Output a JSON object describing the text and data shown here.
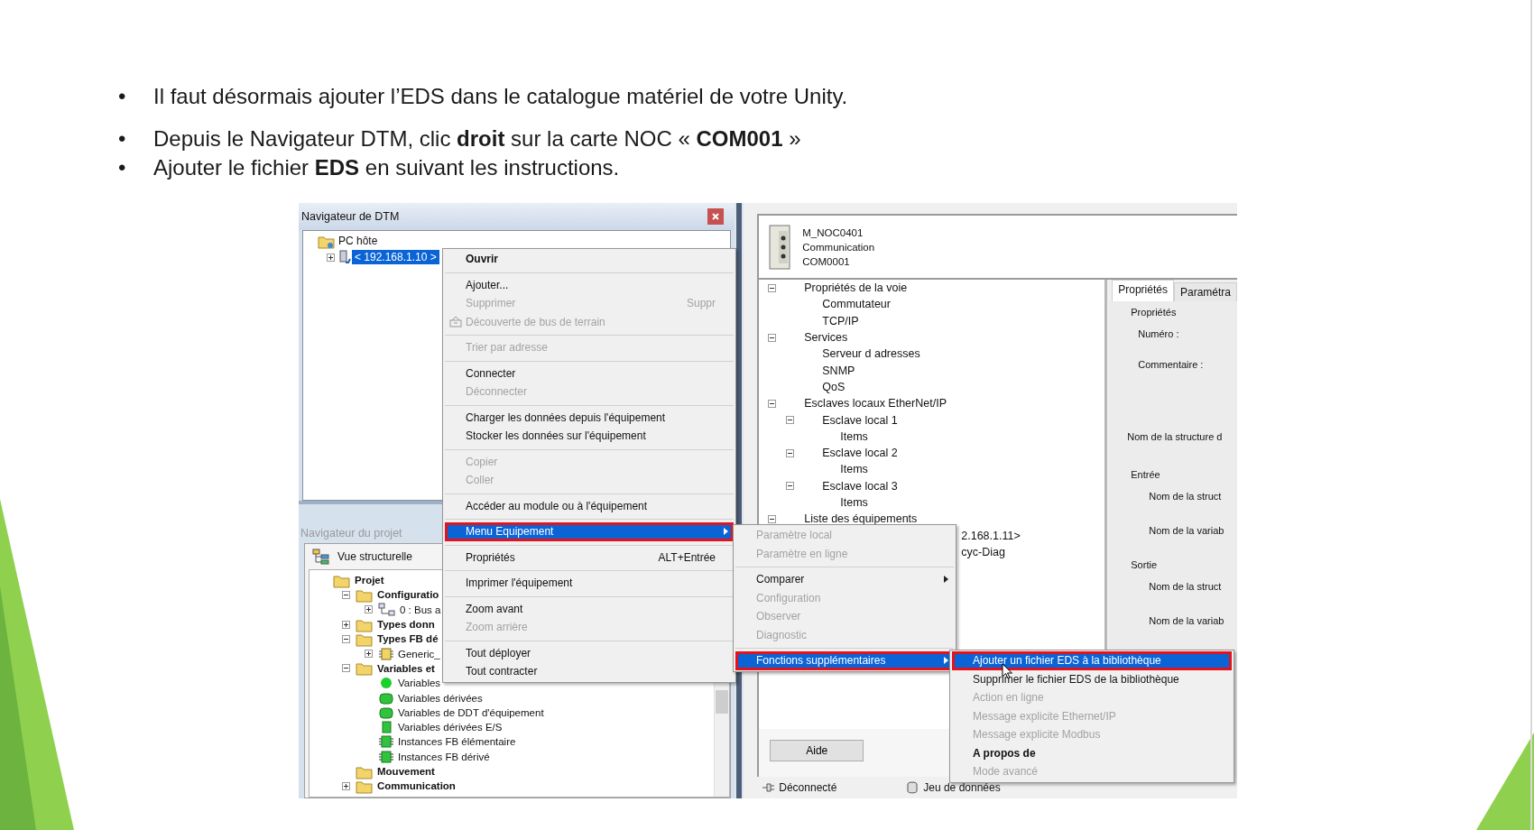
{
  "bullets": [
    {
      "marker": "•",
      "text": "Il faut désormais ajouter l’EDS dans le catalogue matériel de votre Unity."
    },
    {
      "marker": "•",
      "text": "Depuis le Navigateur DTM, clic **droit** sur la carte NOC « **COM001** »"
    },
    {
      "marker": "•",
      "text": "Ajouter le fichier **EDS** en suivant les instructions."
    }
  ],
  "dtm_navigator": {
    "title": "Navigateur de DTM",
    "tree": [
      {
        "label": "PC hôte",
        "kind": "host",
        "selected": false,
        "children": [
          {
            "label": "< 192.168.1.10 >",
            "kind": "device",
            "selected": true,
            "expanded": false
          }
        ]
      }
    ]
  },
  "project_navigator": {
    "title": "Navigateur du projet",
    "view": "Vue structurelle",
    "tree": [
      {
        "label": "Projet",
        "kind": "folder",
        "children": [
          {
            "label": "Configuratio",
            "kind": "folder",
            "expanded": true,
            "children": [
              {
                "label": "0 : Bus a",
                "kind": "network",
                "expanded": false
              }
            ]
          },
          {
            "label": "Types donn",
            "kind": "folder",
            "expanded": false
          },
          {
            "label": "Types FB dé",
            "kind": "folder",
            "expanded": true,
            "children": [
              {
                "label": "Generic_",
                "kind": "chip",
                "expanded": false
              }
            ]
          },
          {
            "label": "Variables et",
            "kind": "folder",
            "expanded": true,
            "children": [
              {
                "label": "Variables",
                "kind": "dot"
              },
              {
                "label": "Variables dérivées",
                "kind": "card"
              },
              {
                "label": "Variables de DDT d'équipement",
                "kind": "card"
              },
              {
                "label": "Variables dérivées E/S",
                "kind": "square"
              },
              {
                "label": "Instances FB élémentaire",
                "kind": "green-chip"
              },
              {
                "label": "Instances FB dérivé",
                "kind": "green-chip"
              }
            ]
          },
          {
            "label": "Mouvement",
            "kind": "folder"
          },
          {
            "label": "Communication",
            "kind": "folder",
            "expanded": false
          }
        ]
      }
    ]
  },
  "device_header": {
    "lines": [
      "M_NOC0401",
      "Communication",
      "COM0001"
    ]
  },
  "channel_tree": [
    {
      "label": "Propriétés de la voie",
      "kind": "node",
      "expanded": true,
      "children": [
        {
          "label": "Commutateur",
          "kind": "node"
        },
        {
          "label": "TCP/IP",
          "kind": "node"
        }
      ]
    },
    {
      "label": "Services",
      "kind": "node",
      "expanded": true,
      "children": [
        {
          "label": "Serveur d adresses",
          "kind": "node"
        },
        {
          "label": "SNMP",
          "kind": "node"
        },
        {
          "label": "QoS",
          "kind": "node"
        }
      ]
    },
    {
      "label": "Esclaves locaux EtherNet/IP",
      "kind": "node",
      "expanded": true,
      "children": [
        {
          "label": "Esclave local 1",
          "kind": "node",
          "expanded": true,
          "children": [
            {
              "label": "Items",
              "kind": "node"
            }
          ]
        },
        {
          "label": "Esclave local 2",
          "kind": "node",
          "expanded": true,
          "children": [
            {
              "label": "Items",
              "kind": "node"
            }
          ]
        },
        {
          "label": "Esclave local 3",
          "kind": "node",
          "expanded": true,
          "children": [
            {
              "label": "Items",
              "kind": "node"
            }
          ]
        }
      ]
    },
    {
      "label": "Liste des équipements",
      "kind": "node",
      "expanded": true,
      "children": [
        {
          "label": "2.168.1.11>",
          "kind": "cut"
        },
        {
          "label": "cyc-Diag",
          "kind": "cut"
        }
      ]
    }
  ],
  "tabs": [
    {
      "label": "Propriétés",
      "selected": true
    },
    {
      "label": "Paramétra",
      "selected": false
    }
  ],
  "properties": [
    {
      "kind": "group",
      "label": "Propriétés"
    },
    {
      "kind": "field",
      "label": "Numéro :"
    },
    {
      "kind": "field-tall",
      "label": "Commentaire :"
    },
    {
      "kind": "heading",
      "label": "Nom de la structure d"
    },
    {
      "kind": "group",
      "label": "Entrée"
    },
    {
      "kind": "sub",
      "label": "Nom de la struct"
    },
    {
      "kind": "sub",
      "label": "Nom de la variab"
    },
    {
      "kind": "group",
      "label": "Sortie"
    },
    {
      "kind": "sub",
      "label": "Nom de la struct"
    },
    {
      "kind": "sub",
      "label": "Nom de la variab"
    }
  ],
  "help_button": "Aide",
  "status_bar": [
    "Déconnecté",
    "Jeu de données"
  ],
  "context_menu": {
    "groups": [
      [
        {
          "label": "Ouvrir",
          "kind": "default",
          "disabled": false,
          "selected": false
        }
      ],
      [
        {
          "label": "Ajouter...",
          "kind": "normal",
          "disabled": false,
          "selected": false
        },
        {
          "label": "Supprimer",
          "kind": "normal",
          "shortcut": "Suppr",
          "disabled": true,
          "selected": false
        },
        {
          "label": "Découverte de bus de terrain",
          "kind": "icon",
          "disabled": true,
          "selected": false
        }
      ],
      [
        {
          "label": "Trier par adresse",
          "kind": "normal",
          "disabled": true,
          "selected": false
        }
      ],
      [
        {
          "label": "Connecter",
          "kind": "normal",
          "disabled": false,
          "selected": false
        },
        {
          "label": "Déconnecter",
          "kind": "normal",
          "disabled": true,
          "selected": false
        }
      ],
      [
        {
          "label": "Charger les données depuis l'équipement",
          "kind": "normal",
          "disabled": false,
          "selected": false
        },
        {
          "label": "Stocker les données sur l'équipement",
          "kind": "normal",
          "disabled": false,
          "selected": false
        }
      ],
      [
        {
          "label": "Copier",
          "kind": "normal",
          "disabled": true,
          "selected": false
        },
        {
          "label": "Coller",
          "kind": "normal",
          "disabled": true,
          "selected": false
        }
      ],
      [
        {
          "label": "Accéder au module ou à l'équipement",
          "kind": "normal",
          "disabled": false,
          "selected": false
        }
      ],
      [
        {
          "label": "Menu Equipement",
          "kind": "submenu",
          "disabled": false,
          "selected": true
        }
      ],
      [
        {
          "label": "Propriétés",
          "kind": "normal",
          "shortcut": "ALT+Entrée",
          "disabled": false,
          "selected": false
        }
      ],
      [
        {
          "label": "Imprimer l'équipement",
          "kind": "normal",
          "disabled": false,
          "selected": false
        }
      ],
      [
        {
          "label": "Zoom avant",
          "kind": "normal",
          "disabled": false,
          "selected": false
        },
        {
          "label": "Zoom arrière",
          "kind": "normal",
          "disabled": true,
          "selected": false
        }
      ],
      [
        {
          "label": "Tout déployer",
          "kind": "normal",
          "disabled": false,
          "selected": false
        },
        {
          "label": "Tout contracter",
          "kind": "normal",
          "disabled": false,
          "selected": false
        }
      ]
    ]
  },
  "equipment_menu": {
    "groups": [
      [
        {
          "label": "Paramètre local",
          "kind": "normal",
          "disabled": true,
          "selected": false
        },
        {
          "label": "Paramètre en ligne",
          "kind": "normal",
          "disabled": true,
          "selected": false
        }
      ],
      [
        {
          "label": "Comparer",
          "kind": "submenu",
          "disabled": false,
          "selected": false
        },
        {
          "label": "Configuration",
          "kind": "normal",
          "disabled": true,
          "selected": false
        },
        {
          "label": "Observer",
          "kind": "normal",
          "disabled": true,
          "selected": false
        },
        {
          "label": "Diagnostic",
          "kind": "normal",
          "disabled": true,
          "selected": false
        }
      ],
      [
        {
          "label": "Fonctions supplémentaires",
          "kind": "submenu",
          "disabled": false,
          "selected": true
        }
      ]
    ]
  },
  "functions_menu": {
    "groups": [
      [
        {
          "label": "Ajouter un fichier EDS à la bibliothèque",
          "kind": "normal",
          "disabled": false,
          "selected": true
        },
        {
          "label": "Supprimer le fichier EDS de la bibliothèque",
          "kind": "normal",
          "disabled": false,
          "selected": false
        },
        {
          "label": "Action en ligne",
          "kind": "normal",
          "disabled": true,
          "selected": false
        },
        {
          "label": "Message explicite Ethernet/IP",
          "kind": "normal",
          "disabled": true,
          "selected": false
        },
        {
          "label": "Message explicite Modbus",
          "kind": "normal",
          "disabled": true,
          "selected": false
        },
        {
          "label": "A propos de",
          "kind": "default",
          "disabled": false,
          "selected": false
        },
        {
          "label": "Mode avancé",
          "kind": "normal",
          "disabled": true,
          "selected": false
        }
      ]
    ]
  }
}
